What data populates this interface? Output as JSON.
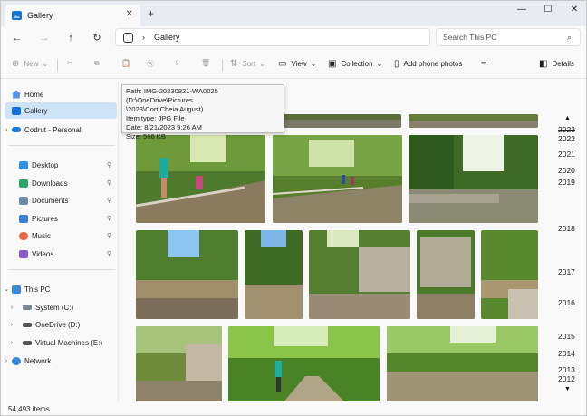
{
  "window": {
    "tab_title": "Gallery",
    "tab_close": "✕",
    "tab_add": "+",
    "minimize": "—",
    "maximize": "☐",
    "close": "✕"
  },
  "nav": {
    "back": "←",
    "forward": "→",
    "up": "↑",
    "refresh": "↻",
    "chevron": "›",
    "location": "Gallery",
    "search_placeholder": "Search This PC",
    "search_icon": "⌕"
  },
  "commands": {
    "new_label": "New",
    "new_caret": "⌄",
    "sort_label": "Sort",
    "view_label": "View",
    "collection_label": "Collection",
    "add_phone_label": "Add phone photos",
    "more": "•••",
    "details_label": "Details"
  },
  "sidebar": {
    "items": [
      {
        "label": "Home"
      },
      {
        "label": "Gallery"
      },
      {
        "label": "Codrut - Personal"
      },
      {
        "label": "Desktop"
      },
      {
        "label": "Downloads"
      },
      {
        "label": "Documents"
      },
      {
        "label": "Pictures"
      },
      {
        "label": "Music"
      },
      {
        "label": "Videos"
      },
      {
        "label": "This PC"
      },
      {
        "label": "System (C:)"
      },
      {
        "label": "OneDrive (D:)"
      },
      {
        "label": "Virtual Machines (E:)"
      },
      {
        "label": "Network"
      }
    ],
    "pin_glyph": "⚲"
  },
  "tooltip": {
    "line1": "Path: IMG-20230821-WA0025 (D:\\OneDrive\\Pictures",
    "line2": "\\2023\\Cort Cheia August)",
    "line3": "Item type: JPG File",
    "line4": "Date: 8/21/2023 9:26 AM",
    "line5": "Size: 566 KB"
  },
  "timeline": {
    "up_arrow": "▲",
    "down_arrow": "▼",
    "years": [
      "2023",
      "2022",
      "2021",
      "2020",
      "2019",
      "2018",
      "2017",
      "2016",
      "2015",
      "2014",
      "2013",
      "2012"
    ]
  },
  "status": {
    "count": "54,493 items"
  },
  "colors": {
    "accent": "#1a6fd4",
    "selected": "#cfe3f7"
  }
}
